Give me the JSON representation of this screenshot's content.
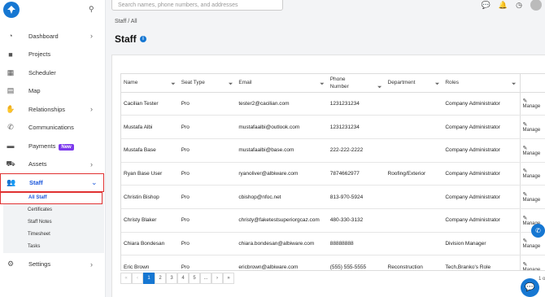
{
  "search": {
    "placeholder": "Search names, phone numbers, and addresses"
  },
  "sidebar": {
    "items": [
      {
        "label": "Dashboard",
        "icon": "dashboard-icon",
        "chevron": true
      },
      {
        "label": "Projects",
        "icon": "briefcase-icon",
        "chevron": false
      },
      {
        "label": "Scheduler",
        "icon": "calendar-icon",
        "chevron": false
      },
      {
        "label": "Map",
        "icon": "map-icon",
        "chevron": false
      },
      {
        "label": "Relationships",
        "icon": "handshake-icon",
        "chevron": true
      },
      {
        "label": "Communications",
        "icon": "phone-icon",
        "chevron": false
      },
      {
        "label": "Payments",
        "icon": "wallet-icon",
        "chevron": false,
        "badge": "New"
      },
      {
        "label": "Assets",
        "icon": "truck-icon",
        "chevron": true
      },
      {
        "label": "Staff",
        "icon": "users-icon",
        "chevron": true
      },
      {
        "label": "Settings",
        "icon": "gear-icon",
        "chevron": true
      }
    ],
    "staff_sub": [
      "All Staff",
      "Certificates",
      "Staff Notes",
      "Timesheet",
      "Tasks"
    ]
  },
  "breadcrumb": "Staff / All",
  "page_title": "Staff",
  "table": {
    "headers": [
      "Name",
      "Seat Type",
      "Email",
      "Phone Number",
      "Department",
      "Roles"
    ],
    "action_label": "Manage",
    "rows": [
      [
        "Cacilian Tester",
        "Pro",
        "tester2@cacilian.com",
        "1231231234",
        "",
        "Company Administrator"
      ],
      [
        "Mustafa Albi",
        "Pro",
        "mustafaalbi@outlook.com",
        "1231231234",
        "",
        "Company Administrator"
      ],
      [
        "Mustafa Base",
        "Pro",
        "mustafaalbi@base.com",
        "222-222-2222",
        "",
        "Company Administrator"
      ],
      [
        "Ryan Base User",
        "Pro",
        "ryanoliver@albiware.com",
        "7874662977",
        "Roofing/Exterior",
        "Company Administrator"
      ],
      [
        "Christin Bishop",
        "Pro",
        "cbishop@nfoc.net",
        "813-970-5924",
        "",
        "Company Administrator"
      ],
      [
        "Christy Blaker",
        "Pro",
        "christy@faketestsuperiorgcaz.com",
        "480-330-3132",
        "",
        "Company Administrator"
      ],
      [
        "Chiara Bondesan",
        "Pro",
        "chiara.bondesan@albiware.com",
        "88888888",
        "",
        "Division Manager"
      ],
      [
        "Eric Brown",
        "Pro",
        "ericbrown@albiware.com",
        "(555) 555-5555",
        "Reconstruction",
        "Tech,Branko's Role"
      ]
    ]
  },
  "pager": {
    "first": "«",
    "prev": "‹",
    "pages": [
      "1",
      "2",
      "3",
      "4",
      "5",
      "..."
    ],
    "next": "›",
    "last": "»",
    "info": "1 o"
  }
}
